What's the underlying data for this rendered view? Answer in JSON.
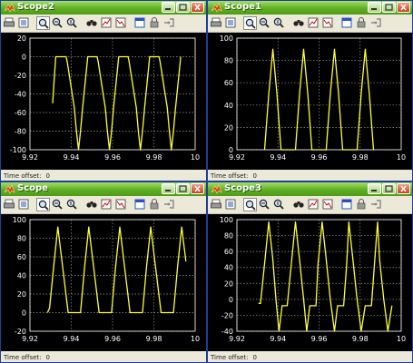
{
  "windows": [
    {
      "id": "scope2",
      "title": "Scope2",
      "time_offset_label": "Time offset:",
      "time_offset_value": "0"
    },
    {
      "id": "scope1",
      "title": "Scope1",
      "time_offset_label": "Time offset:",
      "time_offset_value": "0"
    },
    {
      "id": "scope",
      "title": "Scope",
      "time_offset_label": "Time offset:",
      "time_offset_value": "0"
    },
    {
      "id": "scope3",
      "title": "Scope3",
      "time_offset_label": "Time offset:",
      "time_offset_value": "0"
    }
  ],
  "toolbar_icons": [
    "print-icon",
    "parameters-icon",
    "zoom-icon",
    "zoom-x-icon",
    "zoom-y-icon",
    "autoscale-icon",
    "save-axes-icon",
    "restore-axes-icon",
    "floating-scope-icon",
    "lock-icon",
    "signal-selection-icon"
  ],
  "colors": {
    "trace": "#ffff33",
    "plot_bg": "#000000",
    "axes_bg": "#000000",
    "axis_line": "#ffffff",
    "tick_text": "#ffffff",
    "grid": "#9a9a9a"
  },
  "chart_data": [
    {
      "window": "scope2",
      "type": "line",
      "xlim": [
        9.92,
        10
      ],
      "ylim": [
        -100,
        20
      ],
      "x_ticks": [
        "9.92",
        "9.94",
        "9.96",
        "9.98",
        "10"
      ],
      "y_ticks": [
        "20",
        "0",
        "-20",
        "-40",
        "-60",
        "-80",
        "-100"
      ],
      "x": [
        9.931,
        9.9325,
        9.933,
        9.9375,
        9.938,
        9.9415,
        9.9425,
        9.9435,
        9.9445,
        9.9455,
        9.948,
        9.948,
        9.9525,
        9.953,
        9.9565,
        9.9575,
        9.9585,
        9.9595,
        9.9605,
        9.963,
        9.963,
        9.9675,
        9.968,
        9.9715,
        9.9725,
        9.9735,
        9.9745,
        9.9755,
        9.978,
        9.978,
        9.9825,
        9.983,
        9.9865,
        9.9875,
        9.9885,
        9.9895,
        9.9905,
        9.993
      ],
      "y": [
        -50,
        0,
        0,
        0,
        -5,
        -55,
        -80,
        -100,
        -80,
        -55,
        0,
        0,
        0,
        -5,
        -55,
        -80,
        -100,
        -80,
        -55,
        0,
        0,
        0,
        -5,
        -55,
        -80,
        -100,
        -80,
        -55,
        0,
        0,
        0,
        -5,
        -55,
        -80,
        -100,
        -80,
        -55,
        0
      ]
    },
    {
      "window": "scope1",
      "type": "line",
      "xlim": [
        9.92,
        10
      ],
      "ylim": [
        0,
        100
      ],
      "x_ticks": [
        "9.92",
        "9.94",
        "9.96",
        "9.98",
        "10"
      ],
      "y_ticks": [
        "100",
        "80",
        "60",
        "40",
        "20",
        "0"
      ],
      "x": [
        9.9335,
        9.9355,
        9.9375,
        9.9395,
        9.9415,
        9.9485,
        9.9505,
        9.9525,
        9.9545,
        9.9565,
        9.9635,
        9.9655,
        9.9675,
        9.9695,
        9.9715,
        9.9785,
        9.9805,
        9.9825,
        9.9845,
        9.9865
      ],
      "y": [
        0,
        50,
        90,
        50,
        0,
        0,
        50,
        90,
        50,
        0,
        0,
        50,
        90,
        50,
        0,
        0,
        50,
        90,
        50,
        0
      ]
    },
    {
      "window": "scope",
      "type": "line",
      "xlim": [
        9.92,
        10
      ],
      "ylim": [
        -20,
        100
      ],
      "x_ticks": [
        "9.92",
        "9.94",
        "9.96",
        "9.98",
        "10"
      ],
      "y_ticks": [
        "100",
        "80",
        "60",
        "40",
        "20",
        "0",
        "-20"
      ],
      "x": [
        9.9285,
        9.9295,
        9.9315,
        9.9335,
        9.9355,
        9.9385,
        9.9445,
        9.9465,
        9.9485,
        9.9505,
        9.9535,
        9.9595,
        9.9615,
        9.9635,
        9.9655,
        9.9685,
        9.9745,
        9.9765,
        9.9785,
        9.9805,
        9.9835,
        9.9895,
        9.9915,
        9.9935,
        9.9955
      ],
      "y": [
        0,
        5,
        50,
        92,
        55,
        0,
        0,
        50,
        92,
        55,
        0,
        0,
        50,
        92,
        55,
        0,
        0,
        50,
        92,
        55,
        0,
        0,
        50,
        92,
        55
      ]
    },
    {
      "window": "scope3",
      "type": "line",
      "xlim": [
        9.92,
        10
      ],
      "ylim": [
        -40,
        100
      ],
      "x_ticks": [
        "9.92",
        "9.94",
        "9.96",
        "9.98",
        "10"
      ],
      "y_ticks": [
        "100",
        "80",
        "60",
        "40",
        "20",
        "0",
        "-20",
        "-40"
      ],
      "x": [
        9.9305,
        9.9315,
        9.9335,
        9.9355,
        9.9375,
        9.939,
        9.9405,
        9.942,
        9.9435,
        9.9445,
        9.9465,
        9.9485,
        9.9505,
        9.9525,
        9.954,
        9.9555,
        9.957,
        9.9585,
        9.9595,
        9.9615,
        9.9635,
        9.9655,
        9.9675,
        9.969,
        9.9705,
        9.972,
        9.9735,
        9.9745,
        9.9765,
        9.9785,
        9.9805,
        9.9825,
        9.984,
        9.9855,
        9.987,
        9.9885,
        9.9895,
        9.9915,
        9.9935,
        9.9955
      ],
      "y": [
        -5,
        -5,
        45,
        97,
        50,
        0,
        -40,
        -8,
        -8,
        -8,
        45,
        97,
        50,
        0,
        -40,
        -8,
        -8,
        -8,
        45,
        97,
        50,
        0,
        -40,
        -8,
        -8,
        -8,
        45,
        97,
        50,
        0,
        -40,
        -8,
        -8,
        -8,
        45,
        97,
        50,
        0,
        -40,
        -8
      ]
    }
  ]
}
